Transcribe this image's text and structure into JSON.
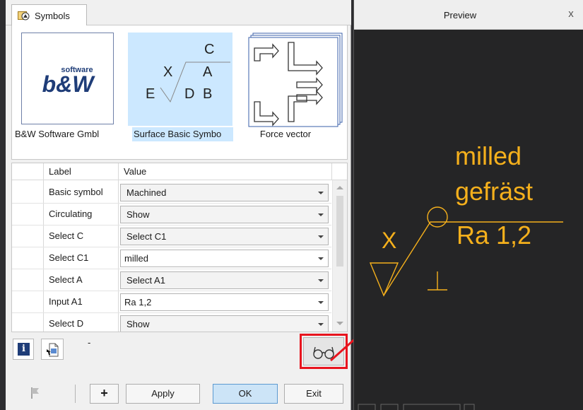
{
  "dialog": {
    "tab": {
      "label": "Symbols",
      "icon": "symbols-icon"
    },
    "gallery": [
      {
        "caption": "B&W Software Gmbl",
        "selected": false
      },
      {
        "caption": "Surface Basic Symbo",
        "selected": true,
        "glyphs": {
          "c": "C",
          "x": "X",
          "a": "A",
          "e": "E",
          "d": "D",
          "b": "B"
        }
      },
      {
        "caption": "Force vector",
        "selected": false
      }
    ],
    "logo_text": {
      "top": "software",
      "mark": "b&W"
    },
    "grid": {
      "headers": {
        "label": "Label",
        "value": "Value"
      },
      "rows": [
        {
          "label": "Basic symbol",
          "value": "Machined"
        },
        {
          "label": "Circulating",
          "value": "Show"
        },
        {
          "label": "Select C",
          "value": "Select C1"
        },
        {
          "label": "Select C1",
          "value": "milled"
        },
        {
          "label": "Select A",
          "value": "Select A1"
        },
        {
          "label": "Input A1",
          "value": "Ra 1,2"
        },
        {
          "label": "Select D",
          "value": "Show"
        }
      ]
    },
    "toolbar": {
      "info_glyph": "i",
      "dash": "-"
    },
    "buttons": {
      "add": "+",
      "apply": "Apply",
      "ok": "OK",
      "exit": "Exit"
    }
  },
  "preview": {
    "title": "Preview",
    "close": "x",
    "symbol_text": {
      "line1": "milled",
      "line2": "gefräst",
      "line3": "Ra 1,2",
      "x": "X"
    }
  },
  "colors": {
    "accent_yellow": "#f5b01c",
    "highlight_red": "#e8141e",
    "selection_blue": "#cce8ff"
  }
}
